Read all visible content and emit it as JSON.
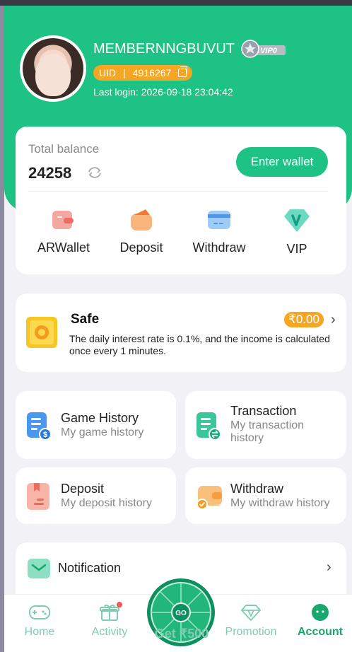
{
  "profile": {
    "username": "MEMBERNNGBUVUT",
    "vip_badge": "VIP0",
    "uid_label": "UID",
    "uid_sep": "|",
    "uid_value": "4916267",
    "last_login": "Last login: 2026-09-18 23:04:42"
  },
  "balance": {
    "label": "Total balance",
    "value": "24258",
    "enter_wallet": "Enter wallet"
  },
  "quick_actions": [
    {
      "label": "ARWallet",
      "icon": "wallet-icon"
    },
    {
      "label": "Deposit",
      "icon": "deposit-icon"
    },
    {
      "label": "Withdraw",
      "icon": "withdraw-card-icon"
    },
    {
      "label": "VIP",
      "icon": "vip-diamond-icon"
    }
  ],
  "safe": {
    "title": "Safe",
    "amount": "₹0.00",
    "description": "The daily interest rate is 0.1%, and the income is calculated once every 1 minutes."
  },
  "history_tiles": [
    {
      "title": "Game History",
      "subtitle": "My game history"
    },
    {
      "title": "Transaction",
      "subtitle": "My transaction history"
    },
    {
      "title": "Deposit",
      "subtitle": "My deposit history"
    },
    {
      "title": "Withdraw",
      "subtitle": "My withdraw history"
    }
  ],
  "notification": {
    "label": "Notification"
  },
  "tabbar": {
    "home": "Home",
    "activity": "Activity",
    "get": "Get ₹500",
    "go": "GO",
    "promotion": "Promotion",
    "account": "Account"
  },
  "colors": {
    "primary": "#1ec285",
    "accent": "#f5a623",
    "background": "#f2f1f6"
  }
}
